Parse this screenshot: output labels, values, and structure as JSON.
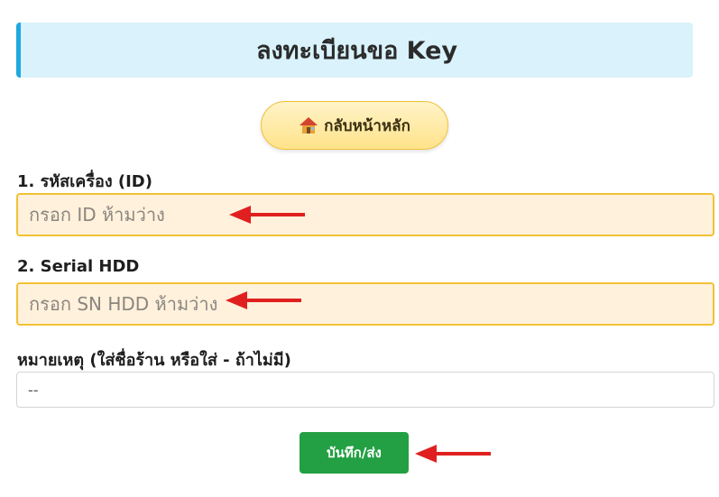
{
  "header": {
    "title": "ลงทะเบียนขอ Key"
  },
  "home_button": {
    "icon": "house-icon",
    "label": "กลับหน้าหลัก"
  },
  "form": {
    "machine_id": {
      "label": "1. รหัสเครื่อง (ID)",
      "placeholder": "กรอก ID ห้ามว่าง",
      "value": ""
    },
    "serial_hdd": {
      "label": "2. Serial HDD",
      "placeholder": "กรอก SN HDD ห้ามว่าง",
      "value": ""
    },
    "note": {
      "label": "หมายเหตุ (ใส่ชื่อร้าน หรือใส่ - ถ้าไม่มี)",
      "value": "--"
    },
    "submit_label": "บันทึก/ส่ง"
  },
  "colors": {
    "header_bg": "#d9f2fb",
    "header_accent": "#1fa8e0",
    "required_bg": "#fff1db",
    "required_border": "#f2c236",
    "submit_bg": "#23a043",
    "arrow": "#e02020"
  }
}
